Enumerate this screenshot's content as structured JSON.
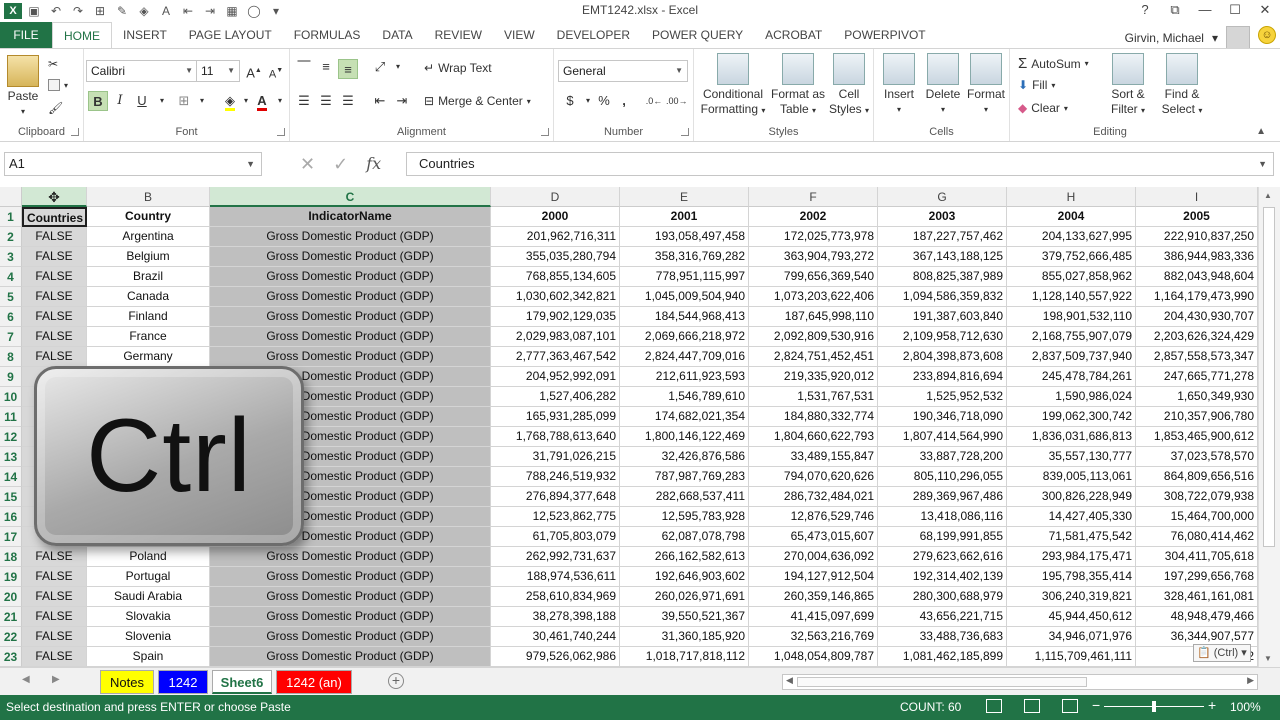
{
  "window": {
    "title": "EMT1242.xlsx - Excel",
    "controls": [
      "?",
      "⧉",
      "—",
      "☐",
      "✕"
    ]
  },
  "ribbon_tabs": [
    "FILE",
    "HOME",
    "INSERT",
    "PAGE LAYOUT",
    "FORMULAS",
    "DATA",
    "REVIEW",
    "VIEW",
    "DEVELOPER",
    "POWER QUERY",
    "ACROBAT",
    "POWERPIVOT"
  ],
  "active_tab": "HOME",
  "user": {
    "name": "Girvin, Michael"
  },
  "ribbon": {
    "clipboard": {
      "label": "Clipboard",
      "paste": "Paste"
    },
    "font": {
      "label": "Font",
      "name": "Calibri",
      "size": "11",
      "bold": "B",
      "italic": "I",
      "underline": "U"
    },
    "alignment": {
      "label": "Alignment",
      "wrap": "Wrap Text",
      "merge": "Merge & Center"
    },
    "number": {
      "label": "Number",
      "format": "General",
      "currency": "$",
      "percent": "%",
      "comma": ","
    },
    "styles": {
      "label": "Styles",
      "conditional": [
        "Conditional",
        "Formatting"
      ],
      "format_table": [
        "Format as",
        "Table"
      ],
      "cell_styles": [
        "Cell",
        "Styles"
      ]
    },
    "cells": {
      "label": "Cells",
      "insert": "Insert",
      "delete": "Delete",
      "format": "Format"
    },
    "editing": {
      "label": "Editing",
      "autosum": "AutoSum",
      "fill": "Fill",
      "clear": "Clear",
      "sort": [
        "Sort &",
        "Filter"
      ],
      "find": [
        "Find &",
        "Select"
      ]
    }
  },
  "formula_bar": {
    "name_box": "A1",
    "fx": "fx",
    "value": "Countries"
  },
  "columns": [
    {
      "id": "A",
      "label": ""
    },
    {
      "id": "B",
      "label": "B"
    },
    {
      "id": "C",
      "label": "C"
    },
    {
      "id": "D",
      "label": "D"
    },
    {
      "id": "E",
      "label": "E"
    },
    {
      "id": "F",
      "label": "F"
    },
    {
      "id": "G",
      "label": "G"
    },
    {
      "id": "H",
      "label": "H"
    },
    {
      "id": "I",
      "label": "I"
    }
  ],
  "header_row": [
    "Countries",
    "Country",
    "IndicatorName",
    "2000",
    "2001",
    "2002",
    "2003",
    "2004",
    "2005"
  ],
  "rows": [
    {
      "n": "2",
      "a": "FALSE",
      "b": "Argentina",
      "c": "Gross Domestic Product (GDP)",
      "v": [
        "201,962,716,311",
        "193,058,497,458",
        "172,025,773,978",
        "187,227,757,462",
        "204,133,627,995",
        "222,910,837,250"
      ]
    },
    {
      "n": "3",
      "a": "FALSE",
      "b": "Belgium",
      "c": "Gross Domestic Product (GDP)",
      "v": [
        "355,035,280,794",
        "358,316,769,282",
        "363,904,793,272",
        "367,143,188,125",
        "379,752,666,485",
        "386,944,983,336"
      ]
    },
    {
      "n": "4",
      "a": "FALSE",
      "b": "Brazil",
      "c": "Gross Domestic Product (GDP)",
      "v": [
        "768,855,134,605",
        "778,951,115,997",
        "799,656,369,540",
        "808,825,387,989",
        "855,027,858,962",
        "882,043,948,604"
      ]
    },
    {
      "n": "5",
      "a": "FALSE",
      "b": "Canada",
      "c": "Gross Domestic Product (GDP)",
      "v": [
        "1,030,602,342,821",
        "1,045,009,504,940",
        "1,073,203,622,406",
        "1,094,586,359,832",
        "1,128,140,557,922",
        "1,164,179,473,990"
      ]
    },
    {
      "n": "6",
      "a": "FALSE",
      "b": "Finland",
      "c": "Gross Domestic Product (GDP)",
      "v": [
        "179,902,129,035",
        "184,544,968,413",
        "187,645,998,110",
        "191,387,603,840",
        "198,901,532,110",
        "204,430,930,707"
      ]
    },
    {
      "n": "7",
      "a": "FALSE",
      "b": "France",
      "c": "Gross Domestic Product (GDP)",
      "v": [
        "2,029,983,087,101",
        "2,069,666,218,972",
        "2,092,809,530,916",
        "2,109,958,712,630",
        "2,168,755,907,079",
        "2,203,626,324,429"
      ]
    },
    {
      "n": "8",
      "a": "FALSE",
      "b": "Germany",
      "c": "Gross Domestic Product (GDP)",
      "v": [
        "2,777,363,467,542",
        "2,824,447,709,016",
        "2,824,751,452,451",
        "2,804,398,873,608",
        "2,837,509,737,940",
        "2,857,558,573,347"
      ]
    },
    {
      "n": "9",
      "a": "",
      "b": "",
      "c": "Gross Domestic Product (GDP)",
      "v": [
        "204,952,992,091",
        "212,611,923,593",
        "219,335,920,012",
        "233,894,816,694",
        "245,478,784,261",
        "247,665,771,278"
      ]
    },
    {
      "n": "10",
      "a": "",
      "b": "",
      "c": "Gross Domestic Product (GDP)",
      "v": [
        "1,527,406,282",
        "1,546,789,610",
        "1,531,767,531",
        "1,525,952,532",
        "1,590,986,024",
        "1,650,349,930"
      ]
    },
    {
      "n": "11",
      "a": "",
      "b": "",
      "c": "Gross Domestic Product (GDP)",
      "v": [
        "165,931,285,099",
        "174,682,021,354",
        "184,880,332,774",
        "190,346,718,090",
        "199,062,300,742",
        "210,357,906,780"
      ]
    },
    {
      "n": "12",
      "a": "",
      "b": "",
      "c": "Gross Domestic Product (GDP)",
      "v": [
        "1,768,788,613,640",
        "1,800,146,122,469",
        "1,804,660,622,793",
        "1,807,414,564,990",
        "1,836,031,686,813",
        "1,853,465,900,612"
      ]
    },
    {
      "n": "13",
      "a": "",
      "b": "",
      "c": "Gross Domestic Product (GDP)",
      "v": [
        "31,791,026,215",
        "32,426,876,586",
        "33,489,155,847",
        "33,887,728,200",
        "35,557,130,777",
        "37,023,578,570"
      ]
    },
    {
      "n": "14",
      "a": "",
      "b": "",
      "c": "Gross Domestic Product (GDP)",
      "v": [
        "788,246,519,932",
        "787,987,769,283",
        "794,070,620,626",
        "805,110,296,055",
        "839,005,113,061",
        "864,809,656,516"
      ]
    },
    {
      "n": "15",
      "a": "",
      "b": "",
      "c": "Gross Domestic Product (GDP)",
      "v": [
        "276,894,377,648",
        "282,668,537,411",
        "286,732,484,021",
        "289,369,967,486",
        "300,826,228,949",
        "308,722,079,938"
      ]
    },
    {
      "n": "16",
      "a": "",
      "b": "",
      "c": "Gross Domestic Product (GDP)",
      "v": [
        "12,523,862,775",
        "12,595,783,928",
        "12,876,529,746",
        "13,418,086,116",
        "14,427,405,330",
        "15,464,700,000"
      ]
    },
    {
      "n": "17",
      "a": "",
      "b": "",
      "c": "Gross Domestic Product (GDP)",
      "v": [
        "61,705,803,079",
        "62,087,078,798",
        "65,473,015,607",
        "68,199,991,855",
        "71,581,475,542",
        "76,080,414,462"
      ]
    },
    {
      "n": "18",
      "a": "FALSE",
      "b": "Poland",
      "c": "Gross Domestic Product (GDP)",
      "v": [
        "262,992,731,637",
        "266,162,582,613",
        "270,004,636,092",
        "279,623,662,616",
        "293,984,175,471",
        "304,411,705,618"
      ]
    },
    {
      "n": "19",
      "a": "FALSE",
      "b": "Portugal",
      "c": "Gross Domestic Product (GDP)",
      "v": [
        "188,974,536,611",
        "192,646,903,602",
        "194,127,912,504",
        "192,314,402,139",
        "195,798,355,414",
        "197,299,656,768"
      ]
    },
    {
      "n": "20",
      "a": "FALSE",
      "b": "Saudi Arabia",
      "c": "Gross Domestic Product (GDP)",
      "v": [
        "258,610,834,969",
        "260,026,971,691",
        "260,359,146,865",
        "280,300,688,979",
        "306,240,319,821",
        "328,461,161,081"
      ]
    },
    {
      "n": "21",
      "a": "FALSE",
      "b": "Slovakia",
      "c": "Gross Domestic Product (GDP)",
      "v": [
        "38,278,398,188",
        "39,550,521,367",
        "41,415,097,699",
        "43,656,221,715",
        "45,944,450,612",
        "48,948,479,466"
      ]
    },
    {
      "n": "22",
      "a": "FALSE",
      "b": "Slovenia",
      "c": "Gross Domestic Product (GDP)",
      "v": [
        "30,461,740,244",
        "31,360,185,920",
        "32,563,216,769",
        "33,488,736,683",
        "34,946,071,976",
        "36,344,907,577"
      ]
    },
    {
      "n": "23",
      "a": "FALSE",
      "b": "Spain",
      "c": "Gross Domestic Product (GDP)",
      "v": [
        "979,526,062,986",
        "1,018,717,818,112",
        "1,048,054,809,787",
        "1,081,462,185,899",
        "1,115,709,461,111",
        "1,157,2"
      ]
    }
  ],
  "overlay": {
    "key_label": "Ctrl",
    "paste_options": "(Ctrl) ▾"
  },
  "sheets": [
    {
      "label": "Notes",
      "bg": "#ffff00",
      "fg": "#111111"
    },
    {
      "label": "1242",
      "bg": "#0000ff",
      "fg": "#ffffff"
    },
    {
      "label": "Sheet6",
      "bg": "#ffffff",
      "fg": "#217346"
    },
    {
      "label": "1242 (an)",
      "bg": "#ff0000",
      "fg": "#ffffff"
    }
  ],
  "active_sheet": "Sheet6",
  "status": {
    "message": "Select destination and press ENTER or choose Paste",
    "count": "COUNT: 60",
    "zoom": "100%"
  },
  "colors": {
    "excel_green": "#217346",
    "selection_fill": "#d2e8d4"
  }
}
